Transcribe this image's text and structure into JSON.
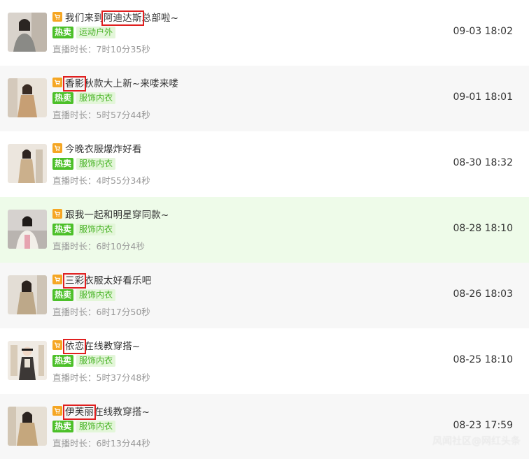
{
  "rows": [
    {
      "title_pre": "我们来到",
      "title_hl": "阿迪达斯",
      "title_post": "总部啦~",
      "hot": "热卖",
      "category": "运动户外",
      "duration_label": "直播时长：",
      "duration": "7时10分35秒",
      "date": "09-03 18:02"
    },
    {
      "title_pre": "",
      "title_hl": "香影",
      "title_post": "秋款大上新~来喽来喽",
      "hot": "热卖",
      "category": "服饰内衣",
      "duration_label": "直播时长：",
      "duration": "5时57分44秒",
      "date": "09-01 18:01"
    },
    {
      "title_pre": "今晚衣服爆炸好看",
      "title_hl": "",
      "title_post": "",
      "hot": "热卖",
      "category": "服饰内衣",
      "duration_label": "直播时长：",
      "duration": "4时55分34秒",
      "date": "08-30 18:32"
    },
    {
      "title_pre": "跟我一起和明星穿同款~",
      "title_hl": "",
      "title_post": "",
      "hot": "热卖",
      "category": "服饰内衣",
      "duration_label": "直播时长：",
      "duration": "6时10分4秒",
      "date": "08-28 18:10"
    },
    {
      "title_pre": "",
      "title_hl": "三彩",
      "title_post": "衣服太好看乐吧",
      "hot": "热卖",
      "category": "服饰内衣",
      "duration_label": "直播时长：",
      "duration": "6时17分50秒",
      "date": "08-26 18:03"
    },
    {
      "title_pre": "",
      "title_hl": "依恋",
      "title_post": "在线教穿搭~",
      "hot": "热卖",
      "category": "服饰内衣",
      "duration_label": "直播时长：",
      "duration": "5时37分48秒",
      "date": "08-25 18:10"
    },
    {
      "title_pre": "",
      "title_hl": "伊芙丽",
      "title_post": "在线教穿搭~",
      "hot": "热卖",
      "category": "服饰内衣",
      "duration_label": "直播时长：",
      "duration": "6时13分44秒",
      "date": "08-23 17:59"
    }
  ],
  "watermark": "风闻社区@网红头条",
  "colors": {
    "accent_green": "#4cc029",
    "highlight_red": "#e02020",
    "cart_orange": "#f5a623"
  }
}
